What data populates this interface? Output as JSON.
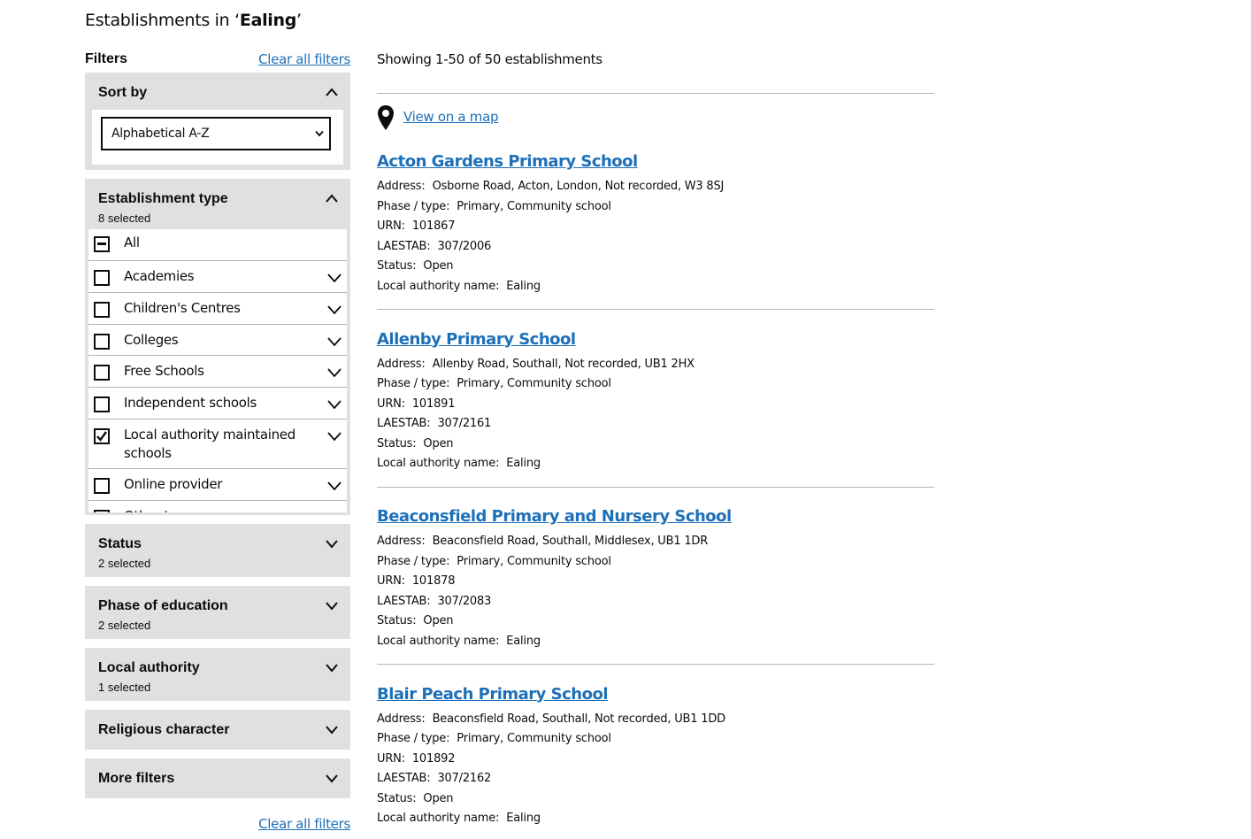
{
  "heading": {
    "prefix": "Establishments in ‘",
    "term": "Ealing",
    "suffix": "’"
  },
  "filters": {
    "title": "Filters",
    "clear_all": "Clear all filters",
    "sort": {
      "title": "Sort by",
      "selected": "Alphabetical A-Z"
    },
    "establishment_type": {
      "title": "Establishment type",
      "selected_count": "8 selected",
      "options": [
        {
          "label": "All",
          "state": "indeterminate"
        },
        {
          "label": "Academies",
          "state": "unchecked"
        },
        {
          "label": "Children's Centres",
          "state": "unchecked"
        },
        {
          "label": "Colleges",
          "state": "unchecked"
        },
        {
          "label": "Free Schools",
          "state": "unchecked"
        },
        {
          "label": "Independent schools",
          "state": "unchecked"
        },
        {
          "label": "Local authority maintained schools",
          "state": "checked"
        },
        {
          "label": "Online provider",
          "state": "unchecked"
        },
        {
          "label": "Other types",
          "state": "unchecked"
        }
      ]
    },
    "status": {
      "title": "Status",
      "selected_count": "2 selected"
    },
    "phase": {
      "title": "Phase of education",
      "selected_count": "2 selected"
    },
    "local_authority": {
      "title": "Local authority",
      "selected_count": "1 selected"
    },
    "religious": {
      "title": "Religious character"
    },
    "more": {
      "title": "More filters"
    }
  },
  "results": {
    "showing": "Showing 1-50 of 50 establishments",
    "map_link": "View on a map",
    "labels": {
      "address": "Address:",
      "phase": "Phase / type:",
      "urn": "URN:",
      "laestab": "LAESTAB:",
      "status": "Status:",
      "la": "Local authority name:"
    },
    "items": [
      {
        "name": "Acton Gardens Primary School",
        "address": "Osborne Road, Acton, London, Not recorded, W3 8SJ",
        "phase": "Primary, Community school",
        "urn": "101867",
        "laestab": "307/2006",
        "status": "Open",
        "la": "Ealing"
      },
      {
        "name": "Allenby Primary School",
        "address": "Allenby Road, Southall, Not recorded, UB1 2HX",
        "phase": "Primary, Community school",
        "urn": "101891",
        "laestab": "307/2161",
        "status": "Open",
        "la": "Ealing"
      },
      {
        "name": "Beaconsfield Primary and Nursery School",
        "address": "Beaconsfield Road, Southall, Middlesex, UB1 1DR",
        "phase": "Primary, Community school",
        "urn": "101878",
        "laestab": "307/2083",
        "status": "Open",
        "la": "Ealing"
      },
      {
        "name": "Blair Peach Primary School",
        "address": "Beaconsfield Road, Southall, Not recorded, UB1 1DD",
        "phase": "Primary, Community school",
        "urn": "101892",
        "laestab": "307/2162",
        "status": "Open",
        "la": "Ealing"
      }
    ]
  },
  "colors": {
    "link": "#1d70b8",
    "panel": "#dee0e2",
    "text": "#0b0c0c",
    "divider": "#b1b4b6"
  }
}
